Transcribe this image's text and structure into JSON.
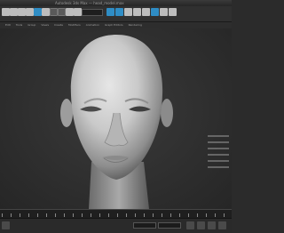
{
  "window": {
    "title": "Autodesk 3ds Max — head_model.max"
  },
  "toolbar": {
    "icons": [
      {
        "name": "select-object-icon",
        "style": "lt"
      },
      {
        "name": "select-by-name-icon",
        "style": "lt"
      },
      {
        "name": "select-move-icon",
        "style": "lt"
      },
      {
        "name": "select-rotate-icon",
        "style": "lt"
      },
      {
        "name": "select-scale-icon",
        "style": "hl"
      },
      {
        "name": "mirror-icon",
        "style": "lt"
      },
      {
        "name": "align-icon",
        "style": "dk"
      },
      {
        "name": "snap-toggle-icon",
        "style": "dk"
      },
      {
        "name": "angle-snap-icon",
        "style": "lt"
      },
      {
        "name": "percent-snap-icon",
        "style": "lt"
      },
      {
        "name": "layer-manager-icon",
        "style": "hl"
      },
      {
        "name": "curve-editor-icon",
        "style": "hl"
      },
      {
        "name": "schematic-view-icon",
        "style": "lt"
      },
      {
        "name": "material-editor-icon",
        "style": "lt"
      },
      {
        "name": "render-setup-icon",
        "style": "lt"
      },
      {
        "name": "rendered-frame-icon",
        "style": "hl"
      },
      {
        "name": "render-production-icon",
        "style": "lt"
      },
      {
        "name": "render-iterative-icon",
        "style": "lt"
      }
    ]
  },
  "menubar": {
    "items": [
      "Edit",
      "Tools",
      "Group",
      "Views",
      "Create",
      "Modifiers",
      "Animation",
      "Graph Editors",
      "Rendering"
    ]
  },
  "viewport": {
    "subject": "head"
  },
  "timeline": {},
  "statusbar": {
    "text": ""
  },
  "colors": {
    "background": "#2b2b2b",
    "highlight": "#2f8dc5"
  }
}
